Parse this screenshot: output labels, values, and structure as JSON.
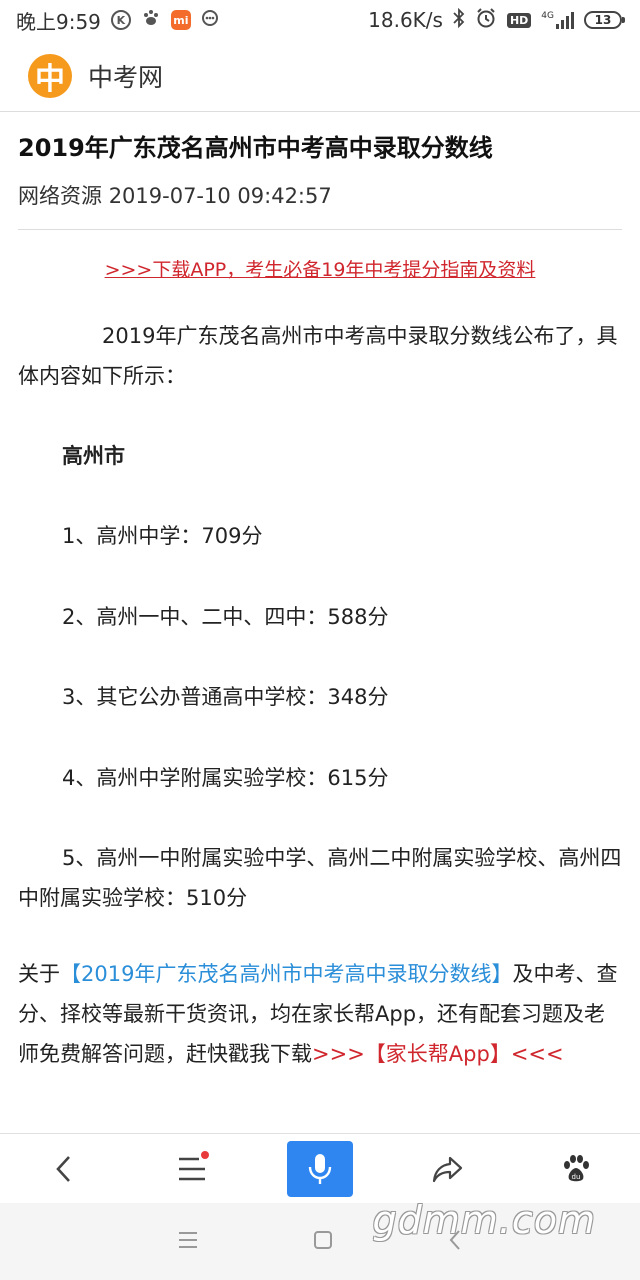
{
  "status_bar": {
    "time": "晚上9:59",
    "network_speed": "18.6K/s",
    "network_type": "4G",
    "hd": "HD",
    "battery": "13",
    "k_icon": "K",
    "mi_icon": "mi"
  },
  "header": {
    "logo_char": "中",
    "site_name": "中考网"
  },
  "article": {
    "title": "2019年广东茂名高州市中考高中录取分数线",
    "source": "网络资源",
    "timestamp": "2019-07-10 09:42:57",
    "promo_link": ">>>下载APP，考生必备19年中考提分指南及资料",
    "intro": "2019年广东茂名高州市中考高中录取分数线公布了，具体内容如下所示：",
    "section_heading": "高州市",
    "items": [
      "1、高州中学：709分",
      "2、高州一中、二中、四中：588分",
      "3、其它公办普通高中学校：348分",
      "4、高州中学附属实验学校：615分",
      "5、高州一中附属实验中学、高州二中附属实验学校、高州四中附属实验学校：510分"
    ]
  },
  "footer": {
    "prefix": "关于",
    "article_link": "【2019年广东茂名高州市中考高中录取分数线】",
    "body": "及中考、查分、择校等最新干货资讯，均在家长帮App，还有配套习题及老师免费解答问题，赶快戳我下载",
    "app_link": ">>>【家长帮App】<<<"
  },
  "toolbar": {
    "icons": [
      "back-icon",
      "menu-icon",
      "microphone-icon",
      "share-icon",
      "baidu-paw-icon"
    ],
    "accent": "#2f86f0",
    "notification_dot": "#e83a3a"
  },
  "watermark": "gdmm.com",
  "colors": {
    "link_red": "#d0262d",
    "link_blue": "#2a8ed8",
    "logo_orange": "#f59a1d"
  }
}
